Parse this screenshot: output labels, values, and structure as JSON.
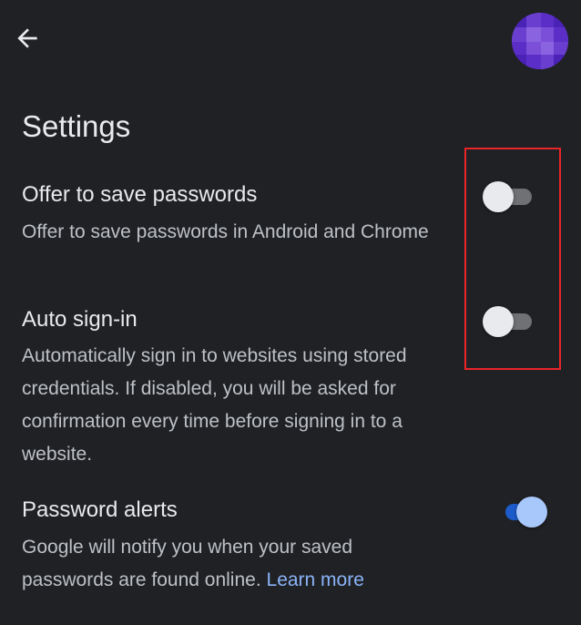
{
  "header": {
    "back_icon": "arrow-left-icon",
    "avatar_colors": [
      "#5b2fc7",
      "#7b4fd8",
      "#4a22b5",
      "#8a63e0"
    ]
  },
  "page": {
    "title": "Settings"
  },
  "settings": [
    {
      "title": "Offer to save passwords",
      "description": "Offer to save passwords in Android and Chrome",
      "enabled": false
    },
    {
      "title": "Auto sign-in",
      "description": "Automatically sign in to websites using stored credentials. If disabled, you will be asked for confirmation every time before signing in to a website.",
      "enabled": false
    },
    {
      "title": "Password alerts",
      "description": "Google will notify you when your saved passwords are found online.",
      "link_text": "Learn more",
      "enabled": true
    }
  ],
  "colors": {
    "background": "#202124",
    "highlight_border": "#e8262a",
    "toggle_on_track": "#1c5bc9",
    "toggle_on_thumb": "#a8c7fa",
    "link": "#8ab4f8"
  }
}
